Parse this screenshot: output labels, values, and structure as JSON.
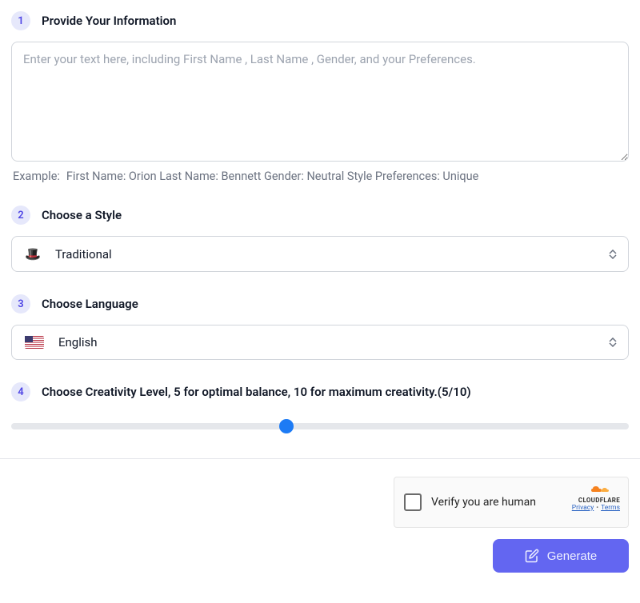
{
  "step1": {
    "number": "1",
    "title": "Provide Your Information",
    "placeholder": "Enter your text here, including First Name , Last Name , Gender, and your Preferences.",
    "example_label": "Example:",
    "example_text": "First Name: Orion Last Name: Bennett Gender: Neutral Style Preferences: Unique"
  },
  "step2": {
    "number": "2",
    "title": "Choose a Style",
    "selected": "Traditional",
    "icon": "🎩"
  },
  "step3": {
    "number": "3",
    "title": "Choose Language",
    "selected": "English"
  },
  "step4": {
    "number": "4",
    "title": "Choose Creativity Level, 5 for optimal balance, 10 for maximum creativity.(5/10)",
    "value": 5,
    "min": 1,
    "max": 10
  },
  "captcha": {
    "text": "Verify you are human",
    "brand": "CLOUDFLARE",
    "privacy": "Privacy",
    "terms": "Terms"
  },
  "generate": {
    "label": "Generate"
  }
}
